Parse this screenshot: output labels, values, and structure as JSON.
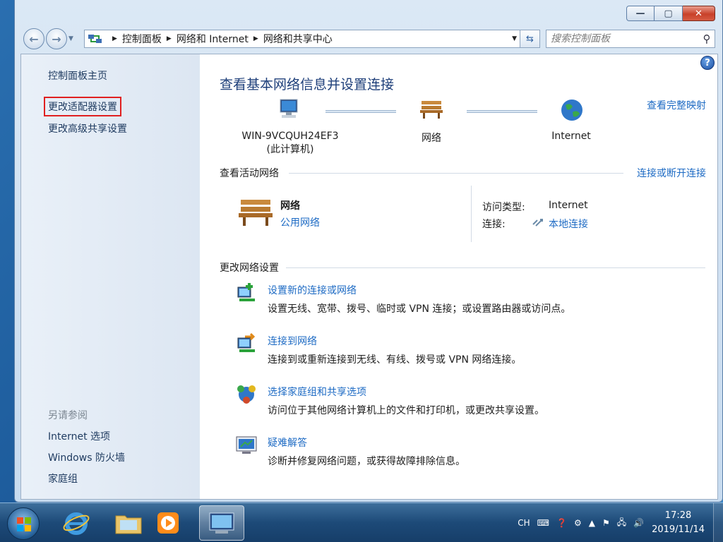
{
  "window": {
    "controls": {
      "minimize": "—",
      "maximize": "▢",
      "close": "✕"
    }
  },
  "nav": {
    "back_icon": "back-arrow-icon",
    "forward_icon": "forward-arrow-icon",
    "breadcrumbs": [
      "控制面板",
      "网络和 Internet",
      "网络和共享中心"
    ],
    "search_placeholder": "搜索控制面板"
  },
  "sidebar": {
    "home": "控制面板主页",
    "adapter_settings": "更改适配器设置",
    "advanced_sharing": "更改高级共享设置",
    "see_also_heading": "另请参阅",
    "see_also": [
      "Internet 选项",
      "Windows 防火墙",
      "家庭组"
    ]
  },
  "main": {
    "title": "查看基本网络信息并设置连接",
    "full_map_link": "查看完整映射",
    "map": {
      "computer_name": "WIN-9VCQUH24EF3",
      "computer_sub": "(此计算机)",
      "network": "网络",
      "internet": "Internet"
    },
    "active_networks": {
      "heading": "查看活动网络",
      "connect_link": "连接或断开连接",
      "network_name": "网络",
      "network_type": "公用网络",
      "access_type_label": "访问类型:",
      "access_type_value": "Internet",
      "connections_label": "连接:",
      "connections_value": "本地连接"
    },
    "change_settings": {
      "heading": "更改网络设置",
      "tasks": [
        {
          "title": "设置新的连接或网络",
          "desc": "设置无线、宽带、拨号、临时或 VPN 连接；或设置路由器或访问点。"
        },
        {
          "title": "连接到网络",
          "desc": "连接到或重新连接到无线、有线、拨号或 VPN 网络连接。"
        },
        {
          "title": "选择家庭组和共享选项",
          "desc": "访问位于其他网络计算机上的文件和打印机，或更改共享设置。"
        },
        {
          "title": "疑难解答",
          "desc": "诊断并修复网络问题，或获得故障排除信息。"
        }
      ]
    }
  },
  "taskbar": {
    "lang": "CH",
    "time": "17:28",
    "date": "2019/11/14"
  }
}
